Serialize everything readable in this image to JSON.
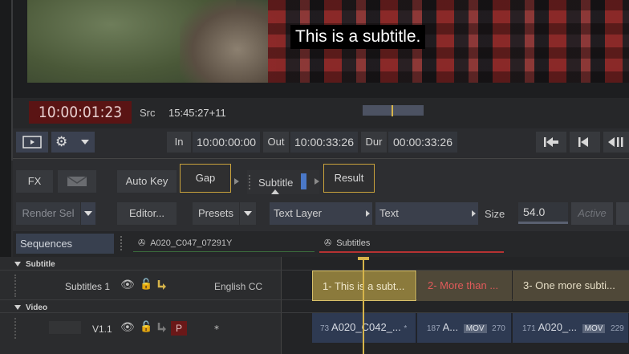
{
  "viewer": {
    "subtitle_text": "This is a subtitle."
  },
  "timecode": {
    "master": "10:00:01:23",
    "src_label": "Src",
    "src_value": "15:45:27+11"
  },
  "transport": {
    "in_label": "In",
    "in_value": "10:00:00:00",
    "out_label": "Out",
    "out_value": "10:00:33:26",
    "dur_label": "Dur",
    "dur_value": "00:00:33:26"
  },
  "effects": {
    "fx_label": "FX",
    "auto_key_label": "Auto Key",
    "gap_label": "Gap",
    "subtitle_label": "Subtitle",
    "result_label": "Result"
  },
  "options": {
    "render_sel_label": "Render Sel",
    "editor_label": "Editor...",
    "presets_label": "Presets",
    "text_layer_label": "Text Layer",
    "text_label": "Text",
    "size_label": "Size",
    "size_value": "54.0",
    "active_label": "Active"
  },
  "sequences": {
    "tab_label": "Sequences",
    "clip_source_name": "A020_C047_07291Y",
    "subtitles_name": "Subtitles"
  },
  "timeline": {
    "subtitle_section": "Subtitle",
    "subtitles_track_name": "Subtitles 1",
    "subtitles_track_lang": "English CC",
    "video_section": "Video",
    "video_track_name": "V1.1",
    "video_track_flag": "P",
    "video_track_extra": "*",
    "subtitle_clips": [
      {
        "text": "1- This is a subt..."
      },
      {
        "text": "2- More than ..."
      },
      {
        "text": "3- One more subti..."
      }
    ],
    "video_clips": [
      {
        "lead": "73",
        "name": "A020_C042_...",
        "tail": "*"
      },
      {
        "lead": "187",
        "name": "A...",
        "badge": "MOV",
        "tail": "270"
      },
      {
        "lead": "171",
        "name": "A020_...",
        "badge": "MOV",
        "tail": "229"
      }
    ]
  },
  "colors": {
    "timecode_bg": "#5a1414",
    "gold_accent": "#c9a23c",
    "subtitle_clip_active": "#8b7a3c",
    "red_accent": "#e04a4a",
    "playhead": "#d6b44a"
  }
}
